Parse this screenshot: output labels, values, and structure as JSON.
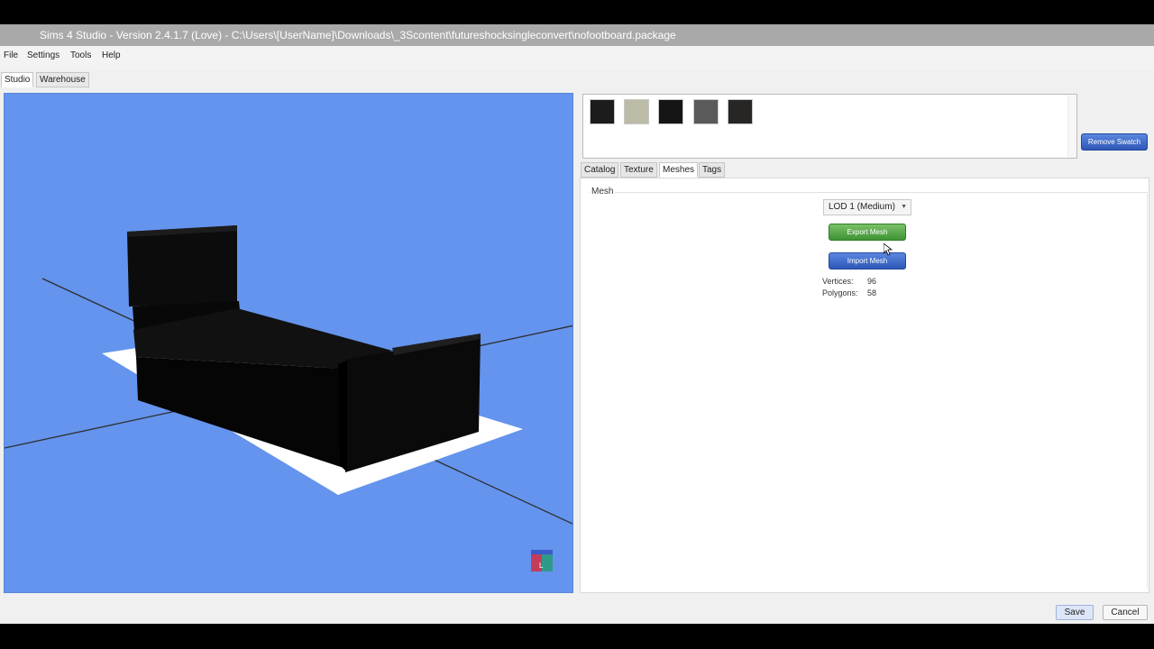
{
  "window": {
    "title": "Sims 4 Studio - Version 2.4.1.7  (Love)     - C:\\Users\\[UserName]\\Downloads\\_3Scontent\\futureshocksingleconvert\\nofootboard.package"
  },
  "menu": {
    "items": [
      "File",
      "Settings",
      "Tools",
      "Help"
    ]
  },
  "main_tabs": [
    {
      "label": "Studio",
      "active": true
    },
    {
      "label": "Warehouse",
      "active": false
    }
  ],
  "swatches": {
    "colors": [
      "#1c1c1c",
      "#bcbca6",
      "#151515",
      "#5a5a5a",
      "#282624"
    ],
    "remove_button": "Remove Swatch"
  },
  "sub_tabs": [
    {
      "label": "Catalog",
      "active": false
    },
    {
      "label": "Texture",
      "active": false
    },
    {
      "label": "Meshes",
      "active": true
    },
    {
      "label": "Tags",
      "active": false
    }
  ],
  "mesh_panel": {
    "group_label": "Mesh",
    "lod_selected": "LOD 1 (Medium)",
    "export_button": "Export Mesh",
    "import_button": "Import Mesh",
    "vertices_label": "Vertices:",
    "vertices_value": "96",
    "polygons_label": "Polygons:",
    "polygons_value": "58"
  },
  "footer": {
    "save": "Save",
    "cancel": "Cancel"
  },
  "colors": {
    "viewport_bg": "#6494ed",
    "export_green": "#4fa540",
    "import_blue": "#3a66c8"
  }
}
